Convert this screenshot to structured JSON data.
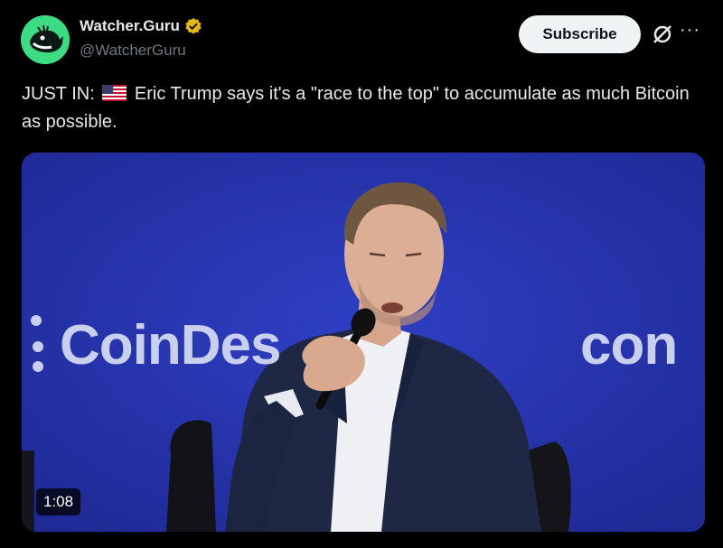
{
  "post": {
    "display_name": "Watcher.Guru",
    "handle": "@WatcherGuru",
    "subscribe_label": "Subscribe",
    "more_label": "···",
    "text_prefix": "JUST IN:",
    "text_body": "Eric Trump says it's a \"race to the top\" to accumulate as much Bitcoin as possible.",
    "flag_icon": "us-flag-icon"
  },
  "media": {
    "logo_left": "CoinDes",
    "logo_right": "con",
    "duration": "1:08"
  },
  "colors": {
    "background": "#000000",
    "avatar": "#3ddc84",
    "verified": "#e2b719",
    "media_bg": "#2633a8"
  }
}
